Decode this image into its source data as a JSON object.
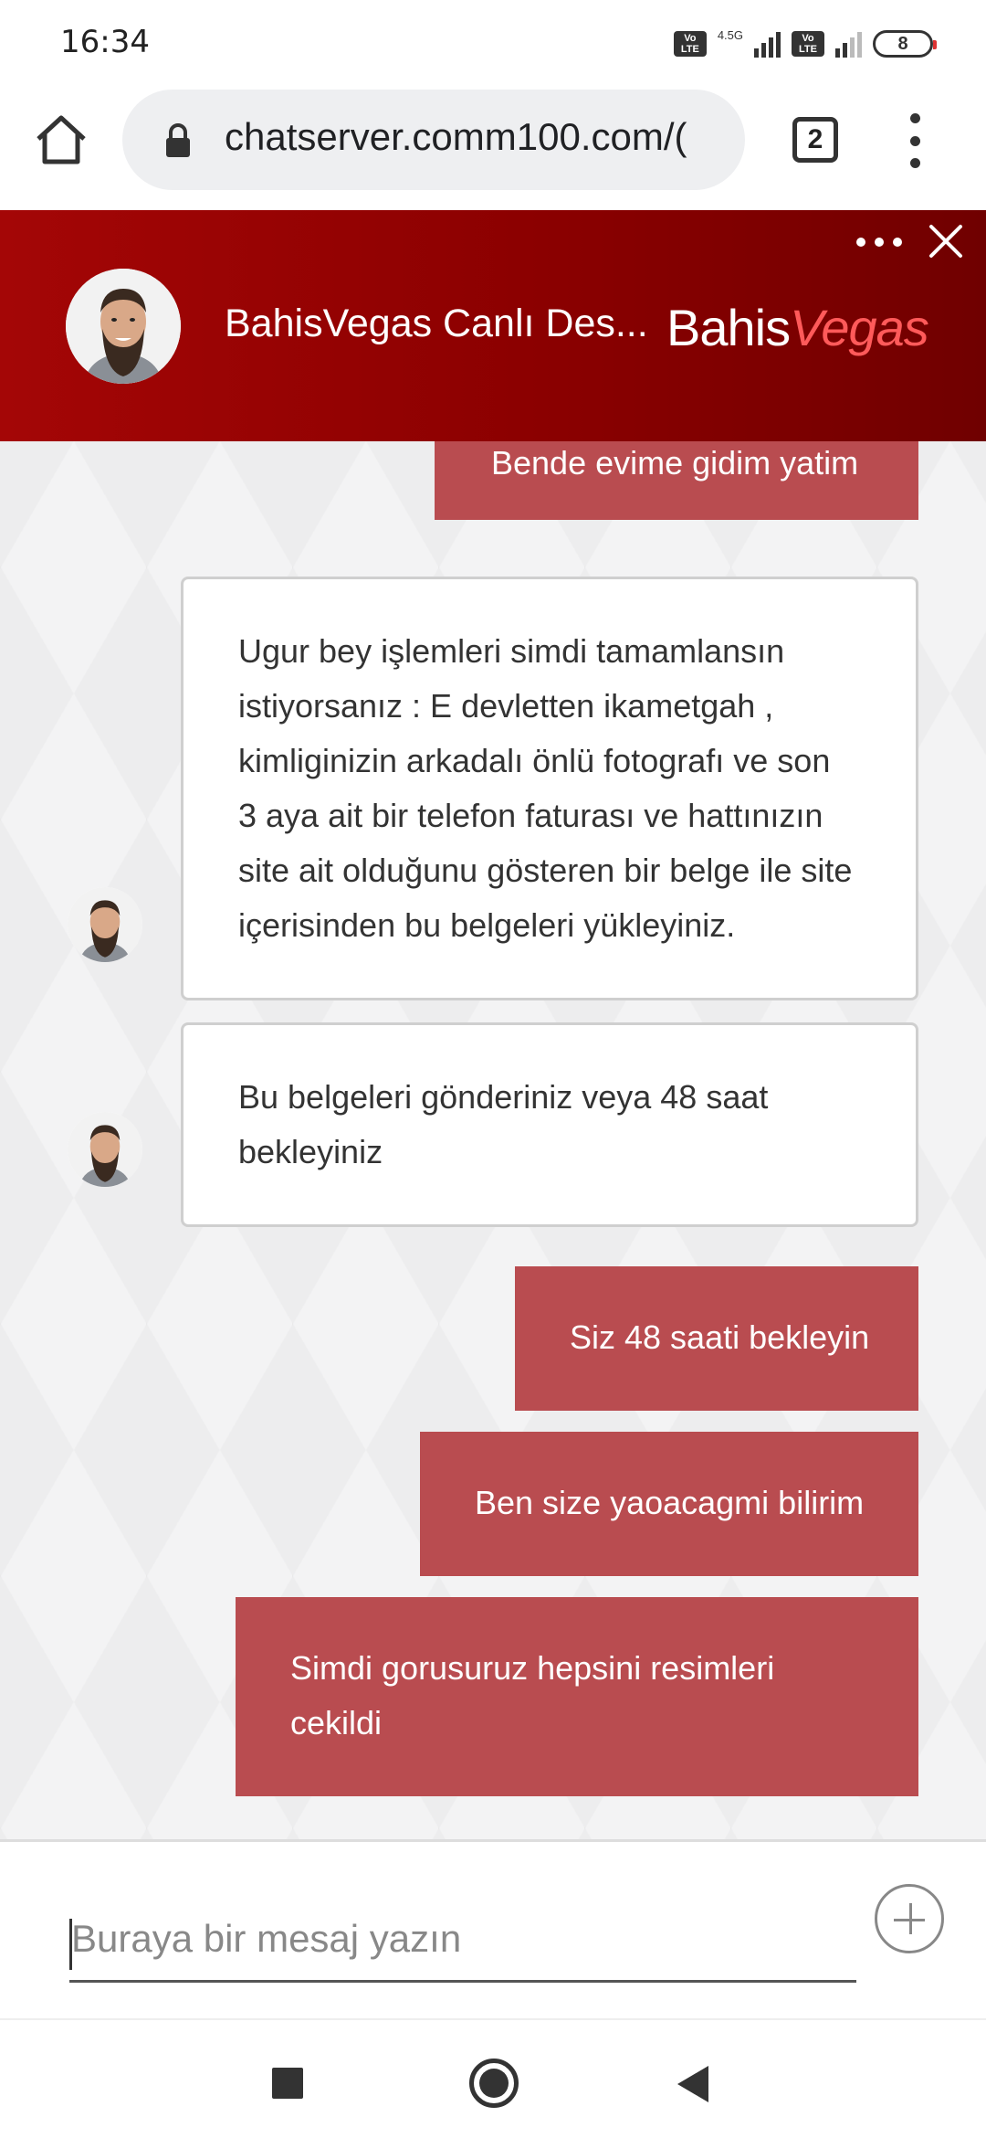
{
  "status_bar": {
    "time": "16:34",
    "network_label": "4.5G",
    "volte_label": "Vo LTE",
    "battery_level": "8"
  },
  "browser": {
    "url": "chatserver.comm100.com/(",
    "tab_count": "2"
  },
  "chat_header": {
    "agent_name": "BahisVegas Canlı Des...",
    "brand_part1": "Bahis",
    "brand_part2": "Vegas"
  },
  "messages": [
    {
      "from": "user",
      "text": "Bende evime gidim yatim"
    },
    {
      "from": "agent",
      "lines": [
        "Ugur bey işlemleri simdi tamamlansın",
        "istiyorsanız : E devletten ikametgah ,",
        "kimliginizin arkadalı önlü fotografı ve son",
        "3 aya ait bir telefon faturası ve hattınızın",
        "site ait olduğunu gösteren bir belge ile site",
        "içerisinden bu belgeleri yükleyiniz."
      ]
    },
    {
      "from": "agent",
      "lines": [
        "Bu belgeleri gönderiniz veya 48 saat",
        "bekleyiniz"
      ]
    },
    {
      "from": "user",
      "text": "Siz 48 saati bekleyin"
    },
    {
      "from": "user",
      "text": "Ben size yaoacagmi bilirim"
    },
    {
      "from": "user",
      "lines": [
        "Simdi gorusuruz hepsini resimleri",
        "cekildi"
      ]
    }
  ],
  "input": {
    "placeholder": "Buraya bir mesaj yazın"
  },
  "icons": {
    "home": "home-icon",
    "lock": "lock-icon",
    "tabs": "tabs-icon",
    "menu": "more-vertical-icon",
    "more": "more-horizontal-icon",
    "close": "close-icon",
    "plus": "plus-icon"
  },
  "colors": {
    "header_red": "#a40606",
    "user_bubble": "#b94c50",
    "agent_bubble": "#ffffff"
  }
}
